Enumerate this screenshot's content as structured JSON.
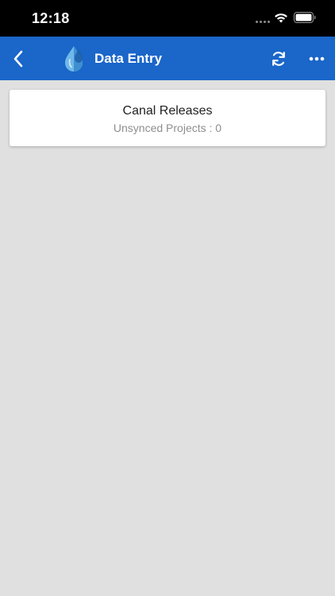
{
  "status_bar": {
    "time": "12:18",
    "icons": [
      "signal-dots-icon",
      "wifi-icon",
      "battery-icon"
    ]
  },
  "app_bar": {
    "title": "Data Entry",
    "color": "#1a66c9",
    "icons": [
      "back-chevron-icon",
      "water-drop-logo-icon",
      "sync-icon",
      "more-dots-icon"
    ]
  },
  "cards": [
    {
      "title": "Canal Releases",
      "subtitle": "Unsynced Projects : 0"
    }
  ],
  "colors": {
    "background": "#e0e0e0",
    "card": "#ffffff",
    "subtitle_text": "#8e8e8e"
  }
}
